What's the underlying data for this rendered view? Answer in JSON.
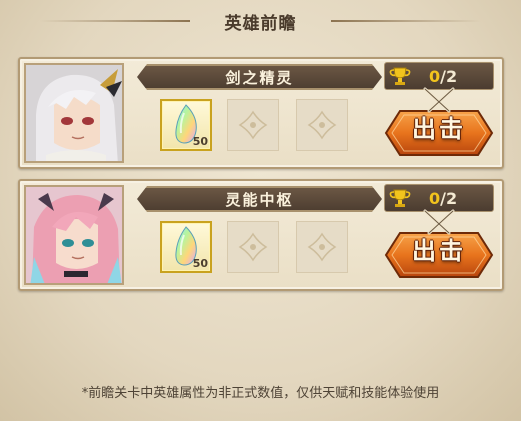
{
  "screen": {
    "title": "英雄前瞻",
    "footnote": "*前瞻关卡中英雄属性为非正式数值，仅供天赋和技能体验使用"
  },
  "heroes": [
    {
      "name": "剑之精灵",
      "progress_current": "0",
      "progress_total": "/2",
      "reward_item": "rainbow-crystal-icon",
      "reward_qty": "50",
      "action_label": "出击"
    },
    {
      "name": "灵能中枢",
      "progress_current": "0",
      "progress_total": "/2",
      "reward_item": "rainbow-crystal-icon",
      "reward_qty": "50",
      "action_label": "出击"
    }
  ],
  "colors": {
    "accent_gold": "#f2c41d",
    "banner_brown": "#4e3e31",
    "button_orange": "#e8741d",
    "parchment": "#eadfc6"
  }
}
